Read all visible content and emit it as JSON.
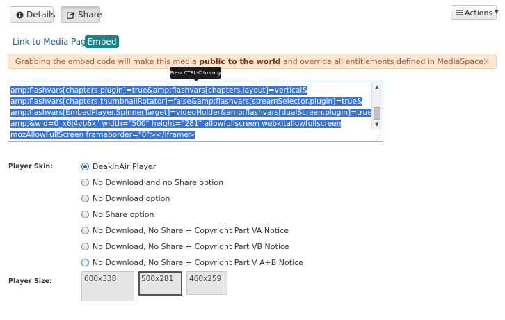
{
  "header": {
    "details_label": "Details",
    "share_label": "Share",
    "actions_label": "Actions"
  },
  "tabs": {
    "link_label": "Link to Media Page",
    "embed_label": "Embed"
  },
  "warning": {
    "before": "Grabbing the embed code will make this media ",
    "emphasis": "public to the world",
    "after": " and override all entitlements defined in MediaSpace.",
    "close": "×"
  },
  "tooltip": "Press CTRL-C to copy",
  "embed_code_lines": [
    "amp;flashvars[chapters.plugin]=true&amp;flashvars[chapters.layout]=vertical&",
    "amp;flashvars[chapters.thumbnailRotator]=false&amp;flashvars[streamSelector.plugin]=true&",
    "amp;flashvars[EmbedPlayer.SpinnerTarget]=videoHolder&amp;flashvars[dualScreen.plugin]=true&",
    "amp;&wid=0_x6j4vb6k\" width=\"500\" height=\"281\" allowfullscreen webkitallowfullscreen",
    "mozAllowFullScreen frameborder=\"0\"></iframe>"
  ],
  "form": {
    "skin_label": "Player Skin:",
    "size_label": "Player Size:",
    "skins": [
      "DeakinAir Player",
      "No Download and no Share option",
      "No Download option",
      "No Share option",
      "No Download, No Share + Copyright Part VA Notice",
      "No Download, No Share + Copyright Part VB Notice",
      "No Download, No Share + Copyright Part V A+B Notice"
    ],
    "selected_skin": "DeakinAir Player",
    "sizes": [
      "600x338",
      "500x281",
      "460x259"
    ],
    "selected_size": "500x281"
  },
  "icons": {
    "details": "info-circle-icon",
    "share": "share-icon",
    "actions": "list-icon"
  }
}
